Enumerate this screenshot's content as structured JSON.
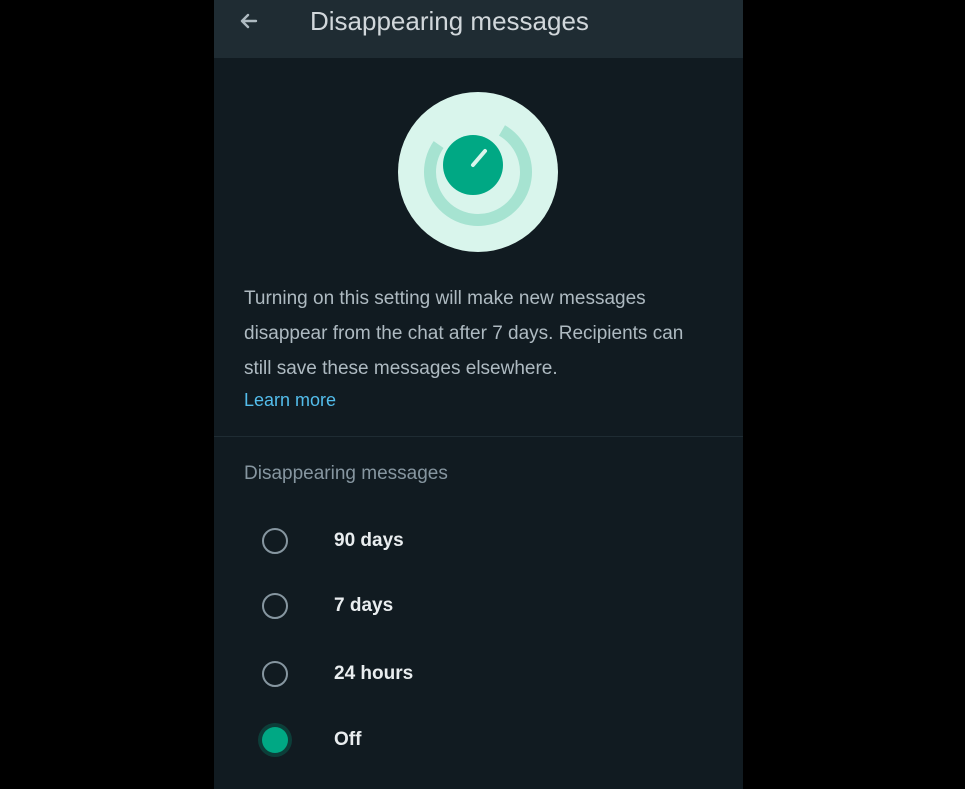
{
  "header": {
    "title": "Disappearing messages"
  },
  "description": {
    "text": "Turning on this setting will make new messages disappear from the chat after 7 days. Recipients can still save these messages elsewhere.",
    "learn_more": "Learn more"
  },
  "section": {
    "label": "Disappearing messages"
  },
  "options": [
    {
      "label": "90 days",
      "selected": false
    },
    {
      "label": "7 days",
      "selected": false
    },
    {
      "label": "24 hours",
      "selected": false
    },
    {
      "label": "Off",
      "selected": true
    }
  ],
  "icons": {
    "back": "arrow-left-icon",
    "hero": "timer-icon"
  },
  "colors": {
    "accent": "#00a884",
    "link": "#53bdeb",
    "background": "#111b21",
    "header": "#1f2c33"
  }
}
